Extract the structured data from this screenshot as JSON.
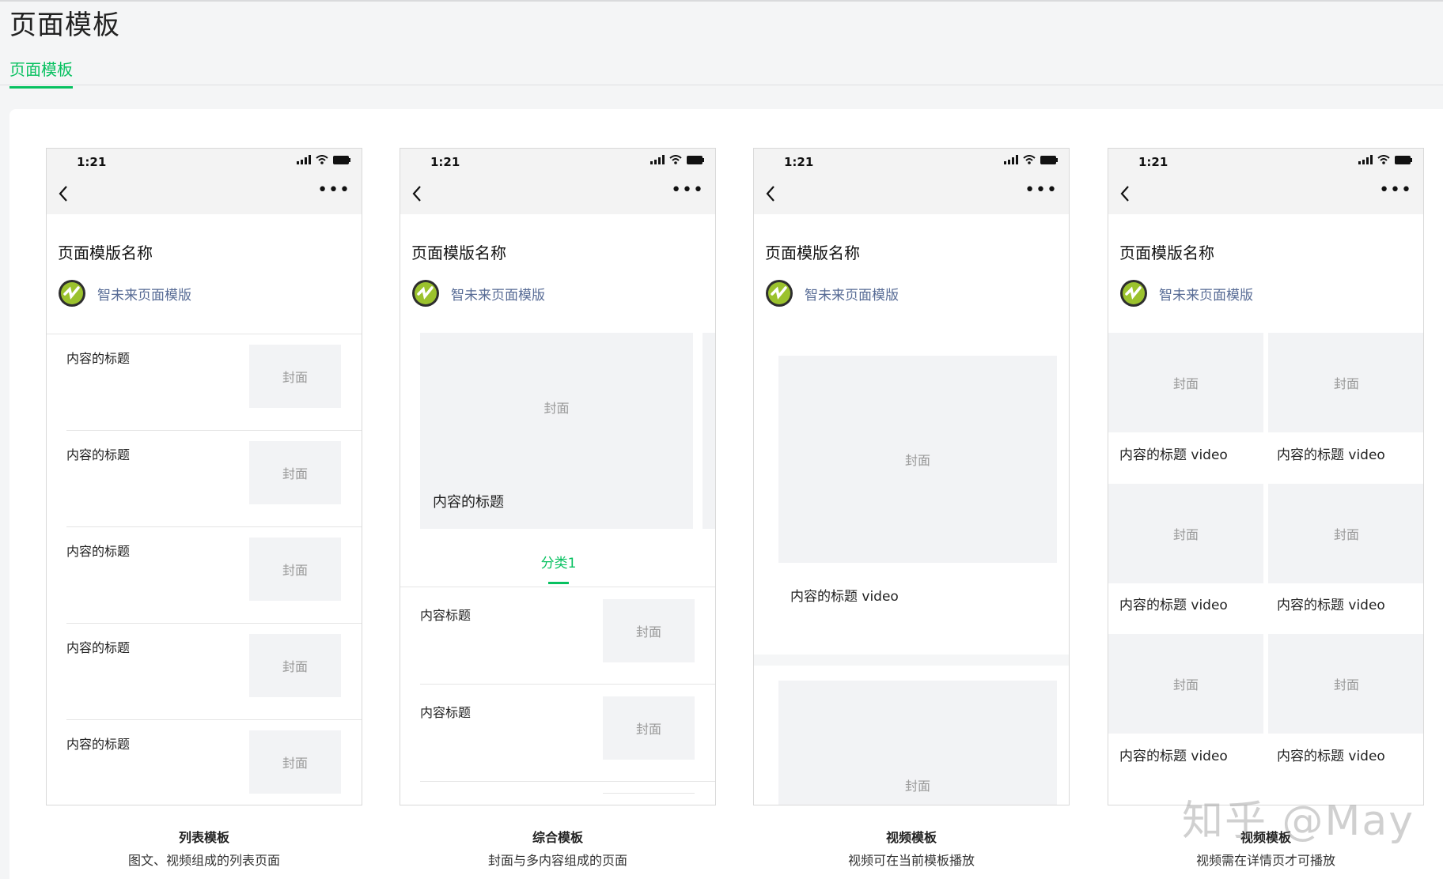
{
  "page": {
    "title": "页面模板",
    "tab": "页面模板"
  },
  "phone": {
    "time": "1:21",
    "template_name": "页面模版名称",
    "account_name": "智未来页面模版",
    "more_label": "•••"
  },
  "labels": {
    "cover": "封面",
    "content_title": "内容的标题",
    "content_heading": "内容标题",
    "content_title_video": "内容的标题 video",
    "category": "分类1"
  },
  "templates": [
    {
      "name": "列表模板",
      "desc": "图文、视频组成的列表页面"
    },
    {
      "name": "综合模板",
      "desc": "封面与多内容组成的页面"
    },
    {
      "name": "视频模板",
      "desc": "视频可在当前模板播放"
    },
    {
      "name": "视频模板",
      "desc": "视频需在详情页才可播放"
    }
  ],
  "watermark": "知乎 @May",
  "colors": {
    "accent": "#07c160",
    "link": "#576b95",
    "cover_bg": "#f2f3f5"
  }
}
